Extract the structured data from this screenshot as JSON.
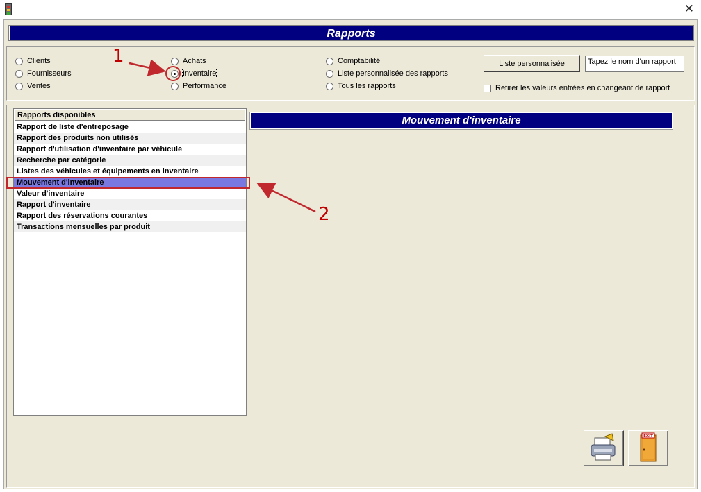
{
  "window": {
    "close_glyph": "✕"
  },
  "header": {
    "title": "Rapports"
  },
  "report_type": {
    "col1": [
      "Clients",
      "Fournisseurs",
      "Ventes"
    ],
    "col2": [
      "Achats",
      "Inventaire",
      "Performance"
    ],
    "col3": [
      "Comptabilité",
      "Liste personnalisée des rapports",
      "Tous les rapports"
    ],
    "selected": "Inventaire"
  },
  "custom": {
    "button_label": "Liste personnalisée",
    "name_value": "Tapez le nom d'un rapport",
    "checkbox_label": "Retirer les valeurs entrées en changeant de rapport"
  },
  "reports": {
    "header": "Rapports disponibles",
    "items": [
      "Rapport de liste d'entreposage",
      "Rapport des produits non utilisés",
      "Rapport d'utilisation d'inventaire par véhicule",
      "Recherche par catégorie",
      "Listes des véhicules et équipements en inventaire",
      "Mouvement d'inventaire",
      "Valeur d'inventaire",
      "Rapport d'inventaire",
      "Rapport des réservations courantes",
      "Transactions mensuelles par produit"
    ],
    "selected_index": 5
  },
  "selected_report_title": "Mouvement d'inventaire",
  "actions": {
    "print_icon": "printer-icon",
    "exit_icon": "exit-door-icon",
    "exit_sign": "EXIT"
  },
  "annotations": {
    "step1": "1",
    "step2": "2",
    "color": "#c0282d"
  }
}
